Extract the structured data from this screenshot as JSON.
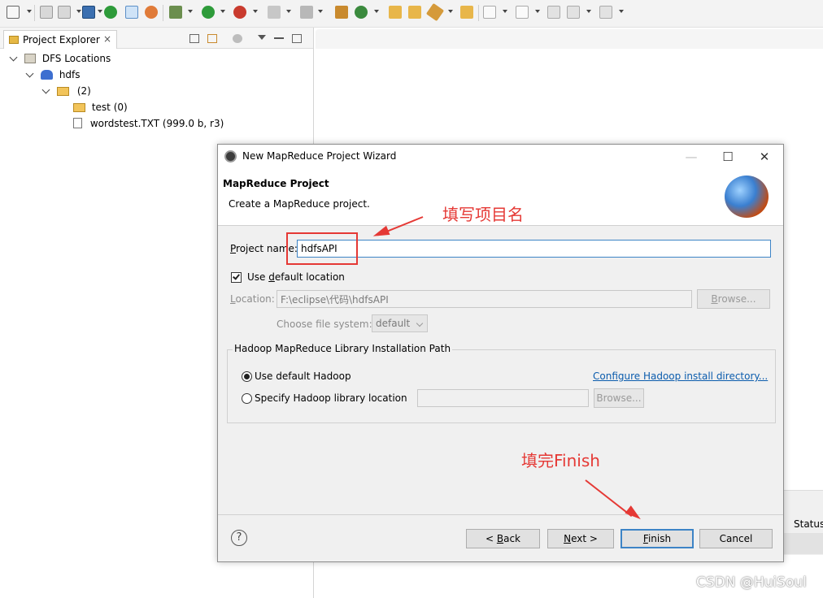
{
  "toolbar": {
    "icons": [
      "new-icon",
      "save-icon",
      "save-all-icon",
      "print-icon",
      "hadoop-icon",
      "perspective-icon",
      "refresh-icon",
      "debug-icon",
      "run-icon",
      "external-tools-icon",
      "stop-icon",
      "build-icon",
      "open-type-icon",
      "new-class-icon",
      "open-folder-icon",
      "open-project-icon",
      "search-icon",
      "open-task-icon",
      "next-annotation-icon",
      "prev-annotation-icon",
      "last-edit-icon",
      "back-icon",
      "forward-icon"
    ]
  },
  "explorer": {
    "tab_label": "Project Explorer",
    "tab_close": "×",
    "tree": [
      {
        "label": "DFS Locations",
        "icon": "dfs-locations-icon"
      },
      {
        "label": "hdfs",
        "icon": "elephant-icon"
      },
      {
        "label": "(2)",
        "icon": "folder-open-icon"
      },
      {
        "label": "test (0)",
        "icon": "folder-icon"
      },
      {
        "label": "wordstest.TXT (999.0 b, r3)",
        "icon": "file-icon"
      }
    ]
  },
  "background": {
    "status_column": "Status"
  },
  "dialog": {
    "title": "New MapReduce Project Wizard",
    "minimize": "—",
    "maximize": "☐",
    "close": "✕",
    "header_title": "MapReduce Project",
    "header_subtitle": "Create a MapReduce project.",
    "project_name_label_u": "P",
    "project_name_label_rest": "roject name:",
    "project_name_value": "hdfsAPI",
    "use_default_location_pre": "Use ",
    "use_default_location_u": "d",
    "use_default_location_rest": "efault location",
    "use_default_location_checked": true,
    "location_label_u": "L",
    "location_label_rest": "ocation:",
    "location_value": "F:\\eclipse\\代码\\hdfsAPI",
    "browse_label_pre": "B",
    "browse_label_rest": "rowse...",
    "file_system_label": "Choose file system:",
    "file_system_value": "default",
    "group_title": "Hadoop MapReduce Library Installation Path",
    "radio_default_label": "Use default Hadoop",
    "radio_default_selected": true,
    "radio_specify_label": "Specify Hadoop library location",
    "configure_link": "Configure Hadoop install directory...",
    "browse2_label": "Browse...",
    "help": "?",
    "back_label_pre": "< ",
    "back_label_u": "B",
    "back_label_rest": "ack",
    "next_label_u": "N",
    "next_label_rest": "ext >",
    "finish_label_u": "F",
    "finish_label_rest": "inish",
    "cancel_label": "Cancel"
  },
  "annotations": {
    "fill_name": "填写项目名",
    "fill_finish": "填完Finish",
    "color": "#e53935"
  },
  "watermark": "CSDN @HuiSoul"
}
